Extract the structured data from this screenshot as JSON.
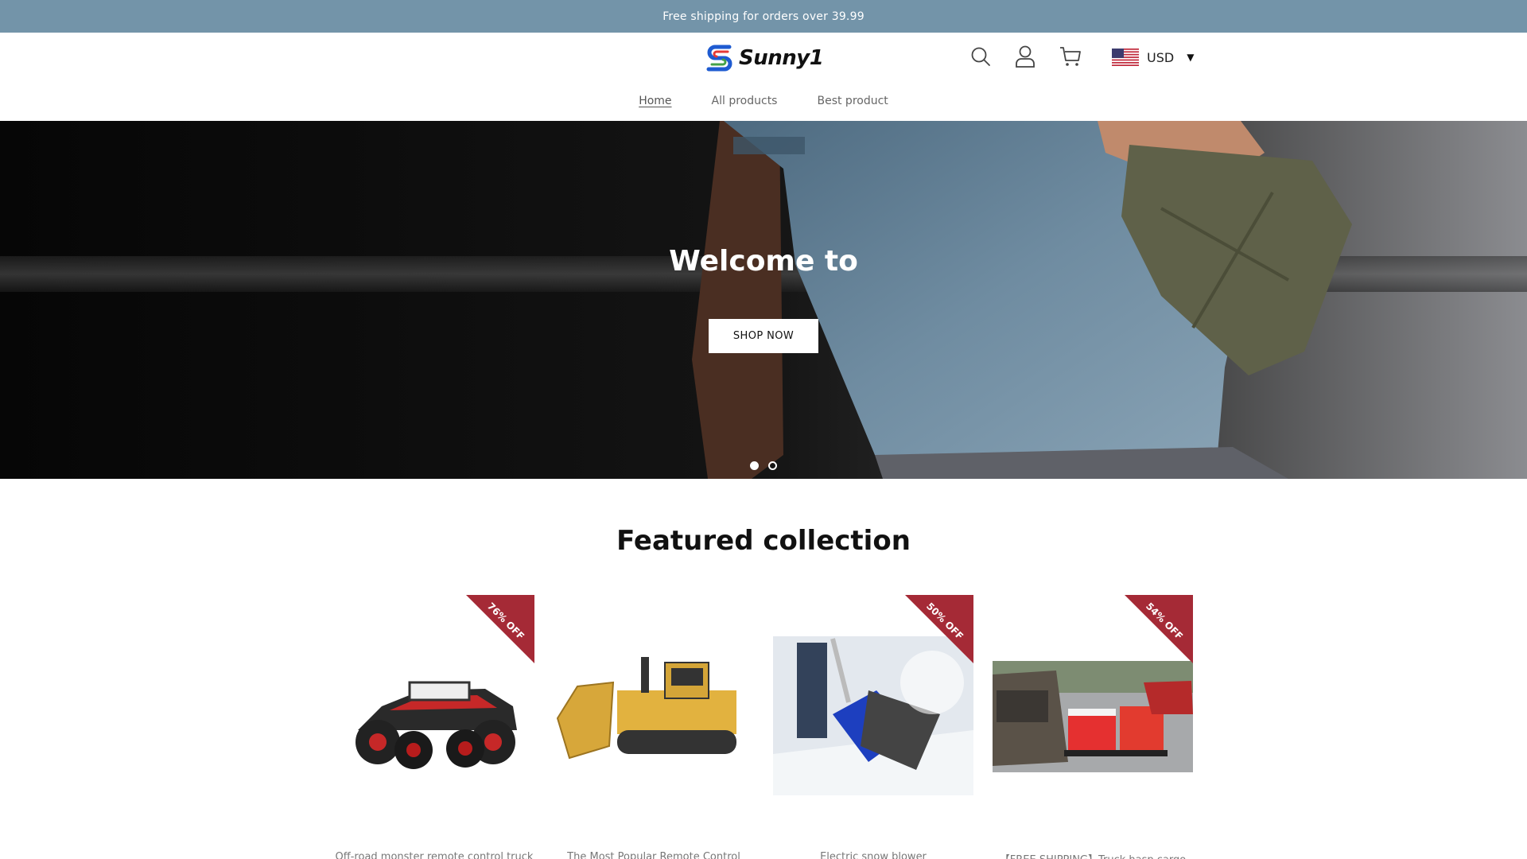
{
  "announcement": "Free shipping for orders over 39.99",
  "brand": {
    "name": "Sunny1"
  },
  "header": {
    "currency": "USD",
    "icons": [
      "search-icon",
      "account-icon",
      "cart-icon",
      "us-flag-icon",
      "chevron-down-icon"
    ]
  },
  "nav": {
    "items": [
      {
        "label": "Home",
        "active": true
      },
      {
        "label": "All products",
        "active": false
      },
      {
        "label": "Best product",
        "active": false
      }
    ]
  },
  "hero": {
    "title": "Welcome to",
    "button": "SHOP NOW",
    "slides": 2,
    "active_slide": 1
  },
  "featured": {
    "title": "Featured collection",
    "products": [
      {
        "name": "Off-road monster remote control truck",
        "badge": "76% OFF"
      },
      {
        "name": "The Most Popular Remote Control",
        "badge": ""
      },
      {
        "name": "Electric snow blower",
        "badge": "50% OFF"
      },
      {
        "name": "【FREE SHIPPING】Truck hasp cargo",
        "badge": "54% OFF"
      }
    ]
  },
  "colors": {
    "announcement_bg": "#7394a9",
    "badge": "#a52a36",
    "hero_bg": "#0b0b0b"
  }
}
